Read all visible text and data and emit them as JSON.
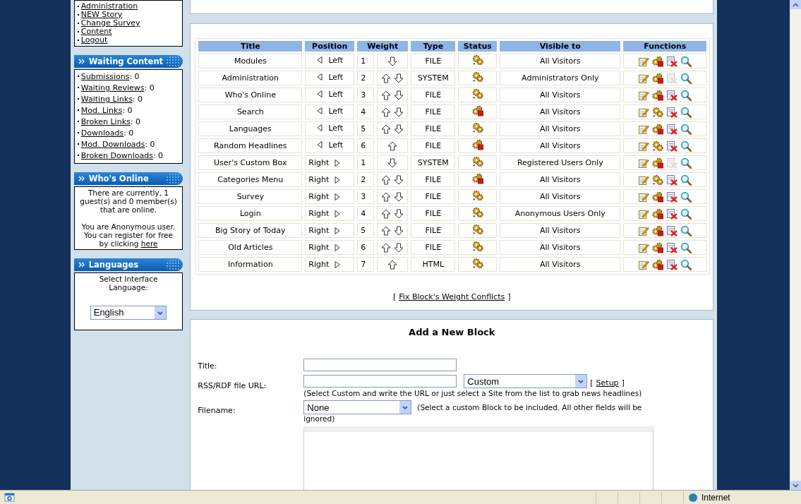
{
  "sidebar": {
    "menu_links": [
      "Administration",
      "NEW Story",
      "Change Survey",
      "Content",
      "Logout"
    ],
    "waiting_content": {
      "title": "Waiting Content",
      "items": [
        {
          "label": "Submissions",
          "suffix": ": 0"
        },
        {
          "label": "Waiting Reviews",
          "suffix": ": 0"
        },
        {
          "label": "Waiting Links",
          "suffix": ": 0"
        },
        {
          "label": "Mod. Links",
          "suffix": ": 0"
        },
        {
          "label": "Broken Links",
          "suffix": ": 0"
        },
        {
          "label": "Downloads",
          "suffix": ": 0"
        },
        {
          "label": "Mod. Downloads",
          "suffix": ": 0"
        },
        {
          "label": "Broken Downloads",
          "suffix": ": 0"
        }
      ]
    },
    "whos_online": {
      "title": "Who's Online",
      "text": "There are currently, 1 guest(s) and 0 member(s) that are online.",
      "register_text": "You are Anonymous user. You can register for free by clicking",
      "register_link": "here"
    },
    "languages": {
      "title": "Languages",
      "label": "Select Interface Language:",
      "value": "English"
    }
  },
  "blocks_table": {
    "columns": [
      "Title",
      "Position",
      "Weight",
      "Type",
      "Status",
      "Visible to",
      "Functions"
    ],
    "rows": [
      {
        "title": "Modules",
        "position": "Left",
        "kind": "left",
        "weight": "1",
        "up": false,
        "down": true,
        "type": "FILE",
        "active": true,
        "visible_to": "All Visitors",
        "deletable": true
      },
      {
        "title": "Administration",
        "position": "Left",
        "kind": "left",
        "weight": "2",
        "up": true,
        "down": true,
        "type": "SYSTEM",
        "active": true,
        "visible_to": "Administrators Only",
        "deletable": false
      },
      {
        "title": "Who's Online",
        "position": "Left",
        "kind": "left",
        "weight": "3",
        "up": true,
        "down": true,
        "type": "FILE",
        "active": true,
        "visible_to": "All Visitors",
        "deletable": true
      },
      {
        "title": "Search",
        "position": "Left",
        "kind": "left",
        "weight": "4",
        "up": true,
        "down": true,
        "type": "FILE",
        "active": false,
        "visible_to": "All Visitors",
        "deletable": true
      },
      {
        "title": "Languages",
        "position": "Left",
        "kind": "left",
        "weight": "5",
        "up": true,
        "down": true,
        "type": "FILE",
        "active": true,
        "visible_to": "All Visitors",
        "deletable": true
      },
      {
        "title": "Random Headlines",
        "position": "Left",
        "kind": "left",
        "weight": "6",
        "up": true,
        "down": false,
        "type": "FILE",
        "active": false,
        "visible_to": "All Visitors",
        "deletable": true
      },
      {
        "title": "User's Custom Box",
        "position": "Right",
        "kind": "right",
        "weight": "1",
        "up": false,
        "down": true,
        "type": "SYSTEM",
        "active": true,
        "visible_to": "Registered Users Only",
        "deletable": false
      },
      {
        "title": "Categories Menu",
        "position": "Right",
        "kind": "right",
        "weight": "2",
        "up": true,
        "down": true,
        "type": "FILE",
        "active": false,
        "visible_to": "All Visitors",
        "deletable": true
      },
      {
        "title": "Survey",
        "position": "Right",
        "kind": "right",
        "weight": "3",
        "up": true,
        "down": true,
        "type": "FILE",
        "active": true,
        "visible_to": "All Visitors",
        "deletable": true
      },
      {
        "title": "Login",
        "position": "Right",
        "kind": "right",
        "weight": "4",
        "up": true,
        "down": true,
        "type": "FILE",
        "active": true,
        "visible_to": "Anonymous Users Only",
        "deletable": true
      },
      {
        "title": "Big Story of Today",
        "position": "Right",
        "kind": "right",
        "weight": "5",
        "up": true,
        "down": true,
        "type": "FILE",
        "active": true,
        "visible_to": "All Visitors",
        "deletable": true
      },
      {
        "title": "Old Articles",
        "position": "Right",
        "kind": "right",
        "weight": "6",
        "up": true,
        "down": true,
        "type": "FILE",
        "active": true,
        "visible_to": "All Visitors",
        "deletable": true
      },
      {
        "title": "Information",
        "position": "Right",
        "kind": "right",
        "weight": "7",
        "up": true,
        "down": false,
        "type": "HTML",
        "active": true,
        "visible_to": "All Visitors",
        "deletable": true
      }
    ]
  },
  "fix_link": {
    "open": "[",
    "label": "Fix Block's Weight Conflicts",
    "close": "]"
  },
  "add_block": {
    "heading": "Add a New Block",
    "title_label": "Title:",
    "url_label": "RSS/RDF file URL:",
    "site_select": "Custom",
    "setup_open": "[",
    "setup_link": "Setup",
    "setup_close": "]",
    "url_hint": "(Select Custom and write the URL or just select a Site from the list to grab news headlines)",
    "filename_label": "Filename:",
    "filename_select": "None",
    "filename_hint_lines": [
      "(Select a custom Block to be included. All other fields will be",
      "ignored)"
    ]
  },
  "status_bar": {
    "zone": "Internet"
  }
}
